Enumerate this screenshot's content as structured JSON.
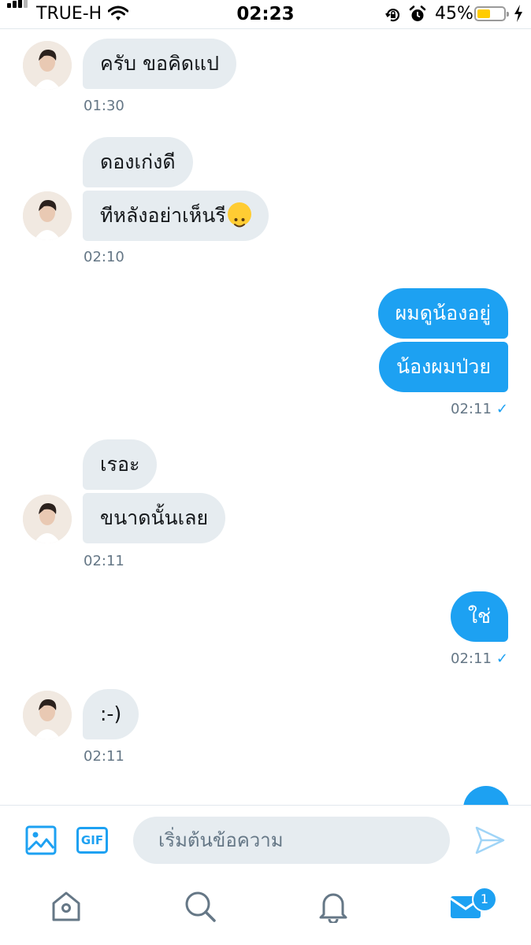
{
  "status_bar": {
    "carrier": "TRUE-H",
    "time": "02:23",
    "battery_percent": "45%",
    "battery_level": 0.45,
    "icons": [
      "signal-icon",
      "wifi-icon",
      "rotation-lock-icon",
      "alarm-icon",
      "battery-icon",
      "charging-bolt-icon"
    ]
  },
  "messages": [
    {
      "direction": "in",
      "bubbles": [
        "ครับ ขอคิดแป"
      ],
      "time": "01:30"
    },
    {
      "direction": "in",
      "bubbles": [
        "ดองเก่งดี",
        "ทีหลังอย่าเห็นรี"
      ],
      "time": "02:10"
    },
    {
      "direction": "out",
      "bubbles": [
        "ผมดูน้องอยู่",
        "น้องผมป่วย"
      ],
      "time": "02:11"
    },
    {
      "direction": "in",
      "bubbles": [
        "เรอะ",
        "ขนาดนั้นเลย"
      ],
      "time": "02:11"
    },
    {
      "direction": "out",
      "bubbles": [
        "ใช่"
      ],
      "time": "02:11"
    },
    {
      "direction": "in",
      "bubbles": [
        ":-)"
      ],
      "time": "02:11"
    }
  ],
  "composer": {
    "placeholder": "เริ่มต้นข้อความ",
    "gif_label": "GIF"
  },
  "tabbar": {
    "items": [
      "home-icon",
      "search-icon",
      "notifications-icon",
      "messages-icon"
    ],
    "messages_badge": "1"
  },
  "colors": {
    "accent": "#1da1f2",
    "incoming_bubble": "#e6ecf0",
    "timestamp": "#657786"
  }
}
